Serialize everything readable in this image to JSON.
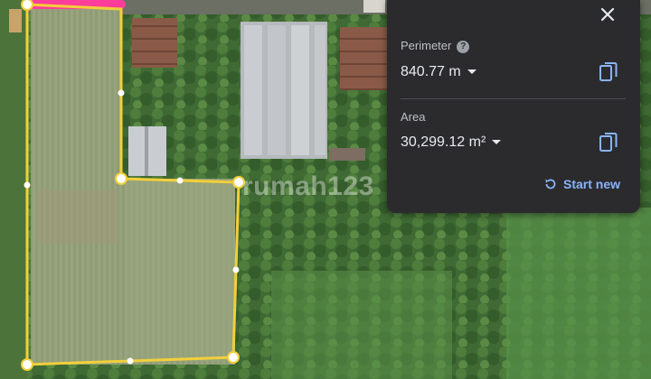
{
  "panel": {
    "perimeter_label": "Perimeter",
    "perimeter_help_icon": "help-circle-icon",
    "perimeter_value": "840.77 m",
    "area_label": "Area",
    "area_value": "30,299.12 m²",
    "start_new_label": "Start new",
    "close_icon": "close-icon",
    "copy_icon": "copy-icon",
    "restart_icon": "restart-icon"
  },
  "watermark": {
    "text": "rumah123"
  },
  "colors": {
    "panel_bg": "#2b2b2e",
    "accent": "#8ab4f8",
    "measure_line": "#f2cf3a",
    "highlight": "#ff3d9a"
  }
}
